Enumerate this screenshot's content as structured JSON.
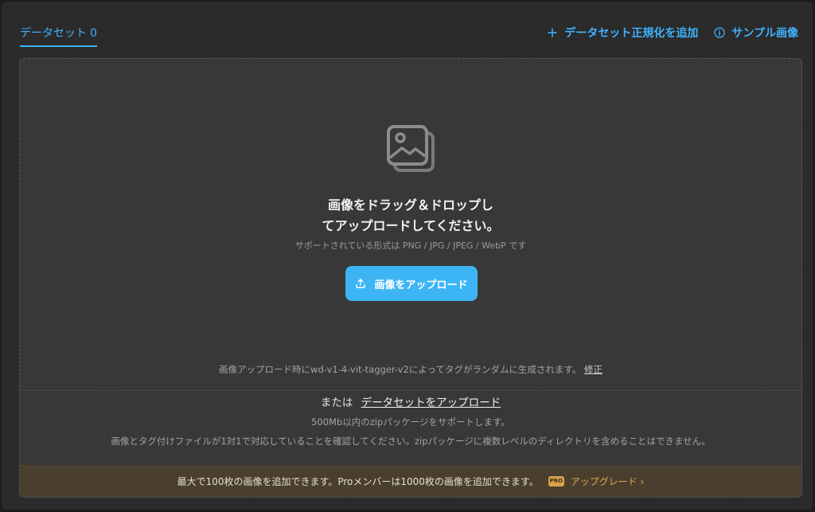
{
  "header": {
    "tab_label": "データセット",
    "tab_count": "0",
    "add_regularization_label": "データセット正規化を追加",
    "sample_images_label": "サンプル画像"
  },
  "dropzone": {
    "title_line1": "画像をドラッグ＆ドロップし",
    "title_line2": "てアップロードしてください。",
    "subtitle": "サポートされている形式は PNG / JPG / JPEG / WebP です",
    "upload_button_label": "画像をアップロード",
    "tagger_note": "画像アップロード時にwd-v1-4-vit-tagger-v2によってタグがランダムに生成されます。",
    "tagger_edit_link": "修正",
    "or_label": "または",
    "upload_dataset_link": "データセットをアップロード",
    "zip_support_note": "500Mb以内のzipパッケージをサポートします。",
    "zip_structure_note": "画像とタグ付けファイルが1対1で対応していることを確認してください。zipパッケージに複数レベルのディレクトリを含めることはできません。"
  },
  "banner": {
    "limit_text": "最大で100枚の画像を追加できます。Proメンバーは1000枚の画像を追加できます。",
    "pro_badge": "PRO",
    "upgrade_label": "アップグレード ›"
  },
  "icons": {
    "plus": "plus-icon",
    "info": "info-circle-icon",
    "image": "image-stack-icon",
    "upload": "upload-icon"
  },
  "colors": {
    "accent": "#3fb2ff",
    "button": "#3db5f5",
    "background": "#2b2b2b",
    "dropzone": "#383838",
    "banner": "#4a3f2e",
    "pro": "#d8a24a"
  }
}
